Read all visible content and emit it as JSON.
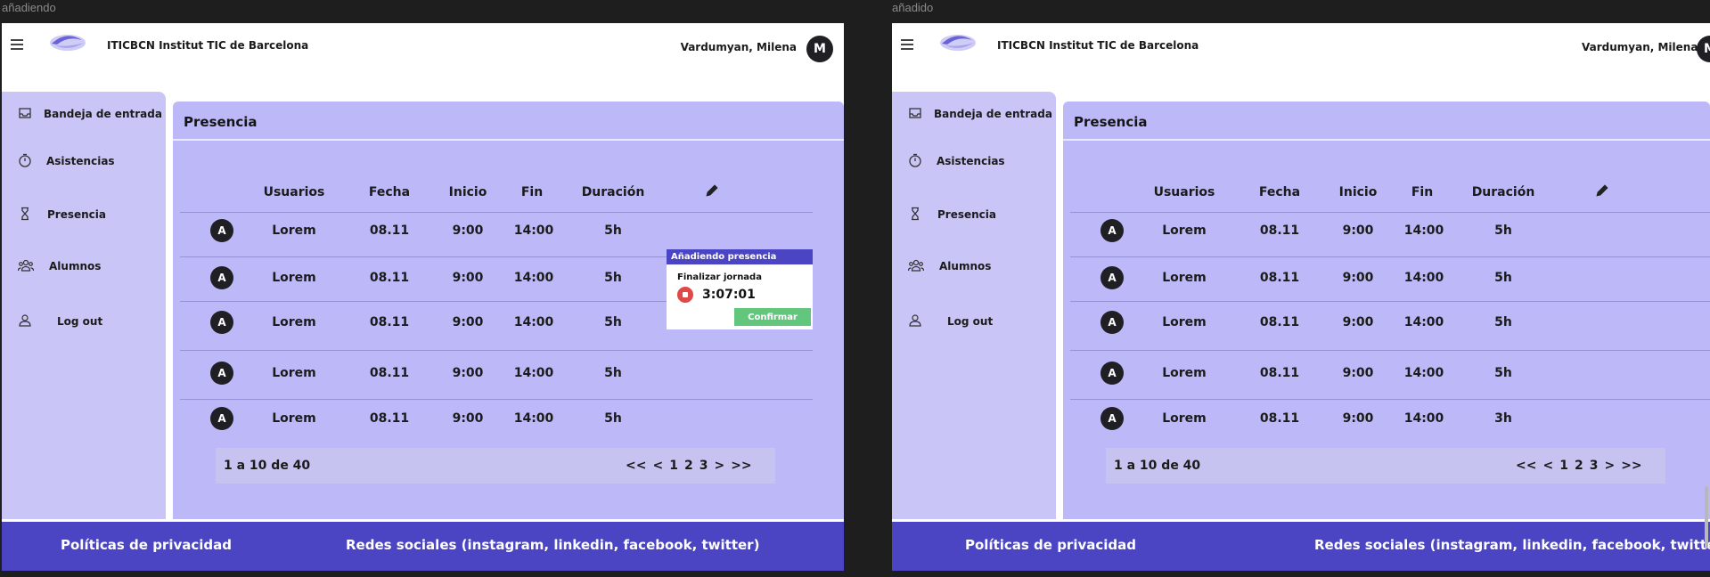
{
  "frames": [
    {
      "label": "añadiendo",
      "header": {
        "org": "ITICBCN Institut TIC de Barcelona",
        "user": "Vardumyan, Milena",
        "avatar_initial": "M"
      },
      "sidebar": {
        "items": [
          {
            "label": "Bandeja de entrada",
            "icon": "inbox-icon"
          },
          {
            "label": "Asistencias",
            "icon": "timer-icon"
          },
          {
            "label": "Presencia",
            "icon": "hourglass-icon"
          },
          {
            "label": "Alumnos",
            "icon": "group-icon"
          },
          {
            "label": "Log out",
            "icon": "user-icon"
          }
        ]
      },
      "main": {
        "title": "Presencia",
        "columns": [
          "Usuarios",
          "Fecha",
          "Inicio",
          "Fin",
          "Duración"
        ],
        "rows": [
          {
            "initial": "A",
            "user": "Lorem",
            "fecha": "08.11",
            "inicio": "9:00",
            "fin": "14:00",
            "duracion": "5h"
          },
          {
            "initial": "A",
            "user": "Lorem",
            "fecha": "08.11",
            "inicio": "9:00",
            "fin": "14:00",
            "duracion": "5h"
          },
          {
            "initial": "A",
            "user": "Lorem",
            "fecha": "08.11",
            "inicio": "9:00",
            "fin": "14:00",
            "duracion": "5h"
          },
          {
            "initial": "A",
            "user": "Lorem",
            "fecha": "08.11",
            "inicio": "9:00",
            "fin": "14:00",
            "duracion": "5h"
          },
          {
            "initial": "A",
            "user": "Lorem",
            "fecha": "08.11",
            "inicio": "9:00",
            "fin": "14:00",
            "duracion": "5h"
          }
        ],
        "pagination": {
          "info": "1 a 10 de 40",
          "first": "<<",
          "prev": "<",
          "pages": [
            "1",
            "2",
            "3"
          ],
          "next": ">",
          "last": ">>"
        }
      },
      "popup": {
        "title": "Añadiendo presencia",
        "subtitle": "Finalizar jornada",
        "timer": "3:07:01",
        "confirm_label": "Confirmar"
      },
      "footer": {
        "privacy": "Políticas de privacidad",
        "social": "Redes sociales (instagram, linkedin, facebook, twitter)"
      }
    },
    {
      "label": "añadido",
      "header": {
        "org": "ITICBCN Institut TIC de Barcelona",
        "user": "Vardumyan, Milena",
        "avatar_initial": "M"
      },
      "sidebar": {
        "items": [
          {
            "label": "Bandeja de entrada",
            "icon": "inbox-icon"
          },
          {
            "label": "Asistencias",
            "icon": "timer-icon"
          },
          {
            "label": "Presencia",
            "icon": "hourglass-icon"
          },
          {
            "label": "Alumnos",
            "icon": "group-icon"
          },
          {
            "label": "Log out",
            "icon": "user-icon"
          }
        ]
      },
      "main": {
        "title": "Presencia",
        "columns": [
          "Usuarios",
          "Fecha",
          "Inicio",
          "Fin",
          "Duración"
        ],
        "rows": [
          {
            "initial": "A",
            "user": "Lorem",
            "fecha": "08.11",
            "inicio": "9:00",
            "fin": "14:00",
            "duracion": "5h"
          },
          {
            "initial": "A",
            "user": "Lorem",
            "fecha": "08.11",
            "inicio": "9:00",
            "fin": "14:00",
            "duracion": "5h"
          },
          {
            "initial": "A",
            "user": "Lorem",
            "fecha": "08.11",
            "inicio": "9:00",
            "fin": "14:00",
            "duracion": "5h"
          },
          {
            "initial": "A",
            "user": "Lorem",
            "fecha": "08.11",
            "inicio": "9:00",
            "fin": "14:00",
            "duracion": "5h"
          },
          {
            "initial": "A",
            "user": "Lorem",
            "fecha": "08.11",
            "inicio": "9:00",
            "fin": "14:00",
            "duracion": "3h"
          }
        ],
        "pagination": {
          "info": "1 a 10 de 40",
          "first": "<<",
          "prev": "<",
          "pages": [
            "1",
            "2",
            "3"
          ],
          "next": ">",
          "last": ">>"
        }
      },
      "footer": {
        "privacy": "Políticas de privacidad",
        "social": "Redes sociales (instagram, linkedin, facebook, twitter)"
      }
    }
  ],
  "colors": {
    "primary": "#4b44c3",
    "sidebar": "#c9c5f7",
    "panel": "#bdb9f9",
    "confirm": "#62c77d",
    "stop": "#e04848"
  }
}
